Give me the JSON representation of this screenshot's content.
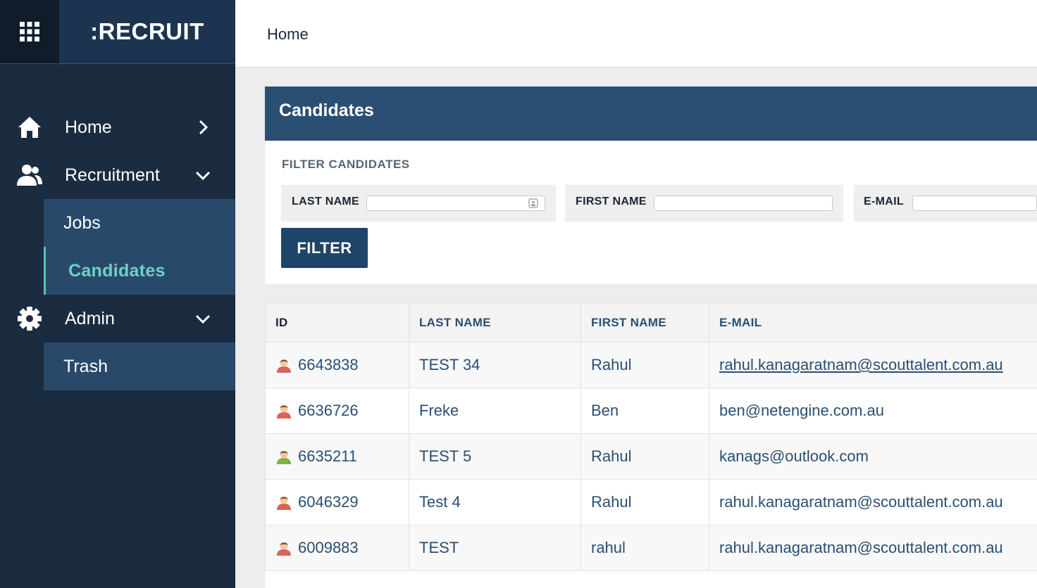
{
  "app": {
    "title": ":RECRUIT"
  },
  "sidebar": {
    "items": [
      {
        "label": "Home",
        "icon": "home-icon"
      },
      {
        "label": "Recruitment",
        "icon": "users-icon"
      },
      {
        "label": "Admin",
        "icon": "gear-icon"
      }
    ],
    "recruitment_children": [
      {
        "label": "Jobs"
      },
      {
        "label": "Candidates",
        "active": true
      }
    ],
    "admin_children": [
      {
        "label": "Trash"
      }
    ]
  },
  "breadcrumb": "Home",
  "panel": {
    "title": "Candidates",
    "filter_title": "FILTER CANDIDATES",
    "fields": [
      {
        "label": "LAST NAME",
        "value": ""
      },
      {
        "label": "FIRST NAME",
        "value": ""
      },
      {
        "label": "E-MAIL",
        "value": ""
      }
    ],
    "filter_button": "FILTER"
  },
  "table": {
    "headers": [
      "ID",
      "LAST NAME",
      "FIRST NAME",
      "E-MAIL"
    ],
    "rows": [
      {
        "id": "6643838",
        "last_name": "TEST 34",
        "first_name": "Rahul",
        "email": "rahul.kanagaratnam@scouttalent.com.au",
        "icon_color": "#d9625a"
      },
      {
        "id": "6636726",
        "last_name": "Freke",
        "first_name": "Ben",
        "email": "ben@netengine.com.au",
        "icon_color": "#d9625a"
      },
      {
        "id": "6635211",
        "last_name": "TEST 5",
        "first_name": "Rahul",
        "email": "kanags@outlook.com",
        "icon_color": "#7cb342"
      },
      {
        "id": "6046329",
        "last_name": "Test 4",
        "first_name": "Rahul",
        "email": "rahul.kanagaratnam@scouttalent.com.au",
        "icon_color": "#d9625a"
      },
      {
        "id": "6009883",
        "last_name": "TEST",
        "first_name": "rahul",
        "email": "rahul.kanagaratnam@scouttalent.com.au",
        "icon_color": "#d9625a"
      }
    ]
  },
  "colors": {
    "sidebar_bg": "#1b2b40",
    "header_blue": "#2a4f73",
    "accent_teal": "#6fd1c3"
  }
}
